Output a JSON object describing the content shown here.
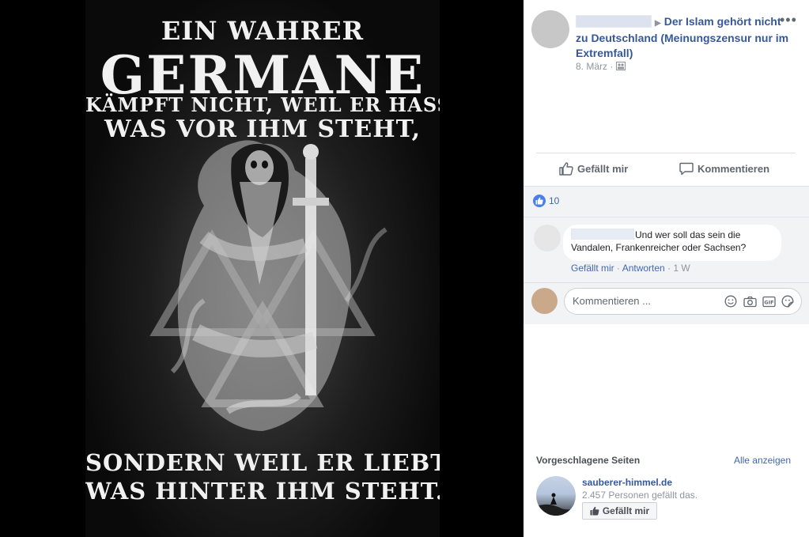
{
  "poster": {
    "line1": "EIN WAHRER",
    "line2": "GERMANE",
    "line3": "KÄMPFT NICHT, WEIL ER HASST,",
    "line4": "WAS VOR IHM STEHT,",
    "line5": "SONDERN WEIL ER LIEBT,",
    "line6": "WAS HINTER IHM STEHT."
  },
  "post": {
    "page_name": "Der Islam gehört nicht zu Deutschland (Meinungszensur nur im Extremfall)",
    "date": "8. März",
    "more_icon": "more-horizontal-icon"
  },
  "actions": {
    "like_label": "Gefällt mir",
    "comment_label": "Kommentieren"
  },
  "reactions": {
    "count": "10"
  },
  "comment": {
    "text": "Und wer soll das sein die Vandalen, Frankenreicher oder Sachsen?",
    "like_link": "Gefällt mir",
    "dot": "·",
    "reply_link": "Antworten",
    "time": "1 W"
  },
  "composer": {
    "placeholder": "Kommentieren ..."
  },
  "suggested": {
    "heading": "Vorgeschlagene Seiten",
    "see_all": "Alle anzeigen",
    "page_name": "sauberer-himmel.de",
    "likes": "2.457 Personen gefällt das.",
    "like_button": "Gefällt mir"
  },
  "colors": {
    "link_blue": "#365899",
    "accent_blue": "#4267b2",
    "muted_gray": "#90949c",
    "panel_bg": "#ffffff",
    "comments_bg": "#f2f3f5"
  }
}
